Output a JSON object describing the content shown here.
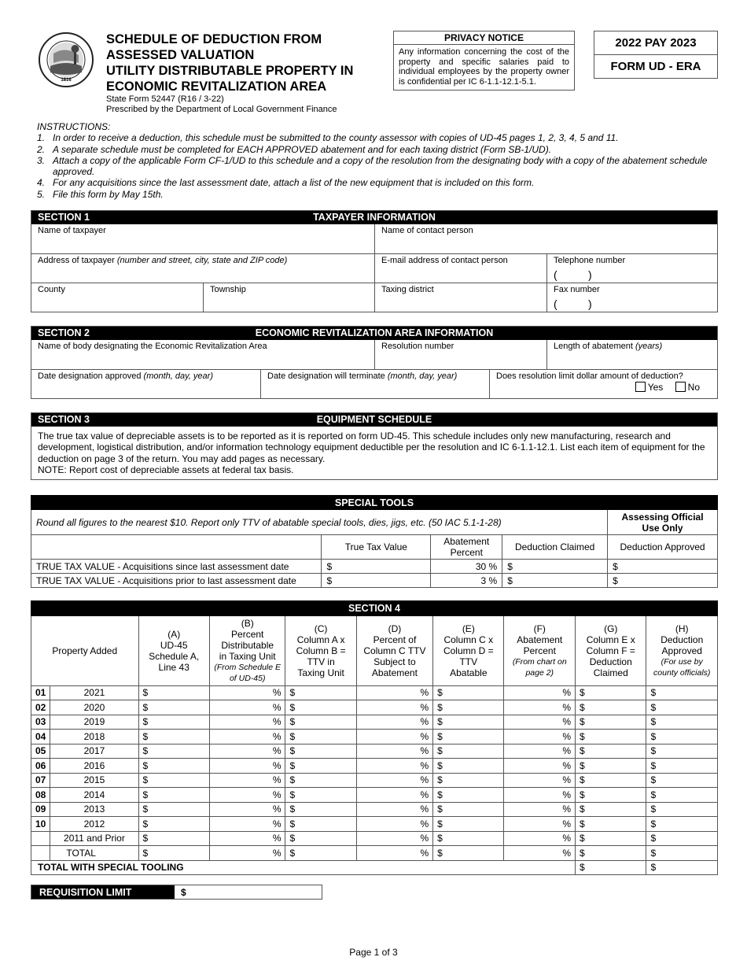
{
  "header": {
    "seal_icon": "indiana-state-seal",
    "title_lines": [
      "SCHEDULE OF DEDUCTION FROM",
      "ASSESSED VALUATION",
      "UTILITY DISTRIBUTABLE PROPERTY IN",
      "ECONOMIC REVITALIZATION AREA"
    ],
    "form_number": "State Form 52447 (R16 / 3-22)",
    "prescribed_by": "Prescribed by the Department of Local Government Finance",
    "privacy_title": "PRIVACY NOTICE",
    "privacy_text": "Any information concerning the cost of the property and specific salaries paid to individual employees by the property owner is confidential per IC 6-1.1-12.1-5.1.",
    "pay_year": "2022 PAY 2023",
    "form_id": "FORM UD - ERA"
  },
  "instructions": {
    "heading": "INSTRUCTIONS:",
    "items": [
      {
        "n": "1.",
        "text": "In order to receive a deduction, this schedule must be submitted to the county assessor with copies of UD-45 pages 1, 2, 3, 4, 5 and 11."
      },
      {
        "n": "2.",
        "text": "A separate schedule must be completed for EACH APPROVED abatement and for each taxing district (Form SB-1/UD)."
      },
      {
        "n": "3.",
        "text": "Attach a copy of the applicable Form CF-1/UD to this schedule and a copy of the resolution from the designating body with a copy of the abatement schedule approved."
      },
      {
        "n": "4.",
        "text": "For any acquisitions since the last assessment date, attach a list of the new equipment that is included on this form."
      },
      {
        "n": "5.",
        "text": "File this form by May 15th."
      }
    ]
  },
  "section1": {
    "label": "SECTION 1",
    "title": "TAXPAYER INFORMATION",
    "name_of_taxpayer": "Name of taxpayer",
    "name_of_contact": "Name of contact person",
    "address_label": "Address of taxpayer ",
    "address_hint": "(number and street, city, state and ZIP code)",
    "email_label": "E-mail address of contact person",
    "telephone_label": "Telephone number",
    "county_label": "County",
    "township_label": "Township",
    "taxing_district_label": "Taxing district",
    "fax_label": "Fax number",
    "paren_open": "(",
    "paren_close": ")"
  },
  "section2": {
    "label": "SECTION 2",
    "title": "ECONOMIC REVITALIZATION AREA INFORMATION",
    "body_label": "Name of body designating the Economic Revitalization Area",
    "resolution_label": "Resolution number",
    "length_label": "Length of abatement ",
    "length_hint": "(years)",
    "approved_label": "Date designation approved ",
    "approved_hint": "(month, day, year)",
    "terminate_label": "Date designation will terminate ",
    "terminate_hint": "(month, day, year)",
    "limit_question": "Does resolution limit dollar amount of deduction?",
    "yes_label": "Yes",
    "no_label": "No"
  },
  "section3": {
    "label": "SECTION 3",
    "title": "EQUIPMENT SCHEDULE",
    "body": "The true tax value of depreciable assets is to be reported as it is reported on form UD-45. This schedule includes only new manufacturing, research and development, logistical distribution, and/or information technology equipment deductible per the resolution and IC 6-1.1-12.1. List each item of equipment for the deduction on page 3 of the return. You may add pages as necessary.",
    "note": "NOTE: Report cost of depreciable assets at federal tax basis."
  },
  "special_tools": {
    "title": "SPECIAL TOOLS",
    "instruction": "Round all figures to the nearest $10. Report only TTV of abatable special tools, dies, jigs, etc. (50 IAC 5.1-1-28)",
    "official_use": "Assessing Official Use Only",
    "columns": [
      "True Tax Value",
      "Abatement Percent",
      "Deduction Claimed",
      "Deduction Approved"
    ],
    "rows": [
      {
        "label": "TRUE TAX VALUE - Acquisitions since last assessment date",
        "ttv": "$",
        "percent": "30 %",
        "claimed": "$",
        "approved": "$"
      },
      {
        "label": "TRUE TAX VALUE - Acquisitions prior to last assessment date",
        "ttv": "$",
        "percent": "3 %",
        "claimed": "$",
        "approved": "$"
      }
    ]
  },
  "section4": {
    "title": "SECTION 4",
    "col_property": "Property Added",
    "columns": [
      {
        "letter": "(A)",
        "lines": [
          "UD-45",
          "Schedule A,",
          "Line 43"
        ],
        "note": ""
      },
      {
        "letter": "(B)",
        "lines": [
          "Percent",
          "Distributable",
          "in Taxing Unit"
        ],
        "note": "(From Schedule E of UD-45)"
      },
      {
        "letter": "(C)",
        "lines": [
          "Column A x",
          "Column B =",
          "TTV in",
          "Taxing Unit"
        ],
        "note": ""
      },
      {
        "letter": "(D)",
        "lines": [
          "Percent of",
          "Column C TTV",
          "Subject to",
          "Abatement"
        ],
        "note": ""
      },
      {
        "letter": "(E)",
        "lines": [
          "Column C x",
          "Column D =",
          "TTV",
          "Abatable"
        ],
        "note": ""
      },
      {
        "letter": "(F)",
        "lines": [
          "Abatement",
          "Percent"
        ],
        "note": "(From chart on page 2)"
      },
      {
        "letter": "(G)",
        "lines": [
          "Column E x",
          "Column F =",
          "Deduction",
          "Claimed"
        ],
        "note": ""
      },
      {
        "letter": "(H)",
        "lines": [
          "Deduction",
          "Approved"
        ],
        "note": "(For use by county officials)"
      }
    ],
    "rows": [
      {
        "num": "01",
        "year": "2021"
      },
      {
        "num": "02",
        "year": "2020"
      },
      {
        "num": "03",
        "year": "2019"
      },
      {
        "num": "04",
        "year": "2018"
      },
      {
        "num": "05",
        "year": "2017"
      },
      {
        "num": "06",
        "year": "2016"
      },
      {
        "num": "07",
        "year": "2015"
      },
      {
        "num": "08",
        "year": "2014"
      },
      {
        "num": "09",
        "year": "2013"
      },
      {
        "num": "10",
        "year": "2012"
      },
      {
        "num": "",
        "year": "2011 and Prior"
      },
      {
        "num": "",
        "year": "TOTAL"
      }
    ],
    "dollar": "$",
    "percent": "%",
    "total_special_label": "TOTAL WITH SPECIAL TOOLING"
  },
  "requisition": {
    "label": "REQUISITION LIMIT",
    "value": "$"
  },
  "footer": {
    "page": "Page 1 of 3"
  }
}
